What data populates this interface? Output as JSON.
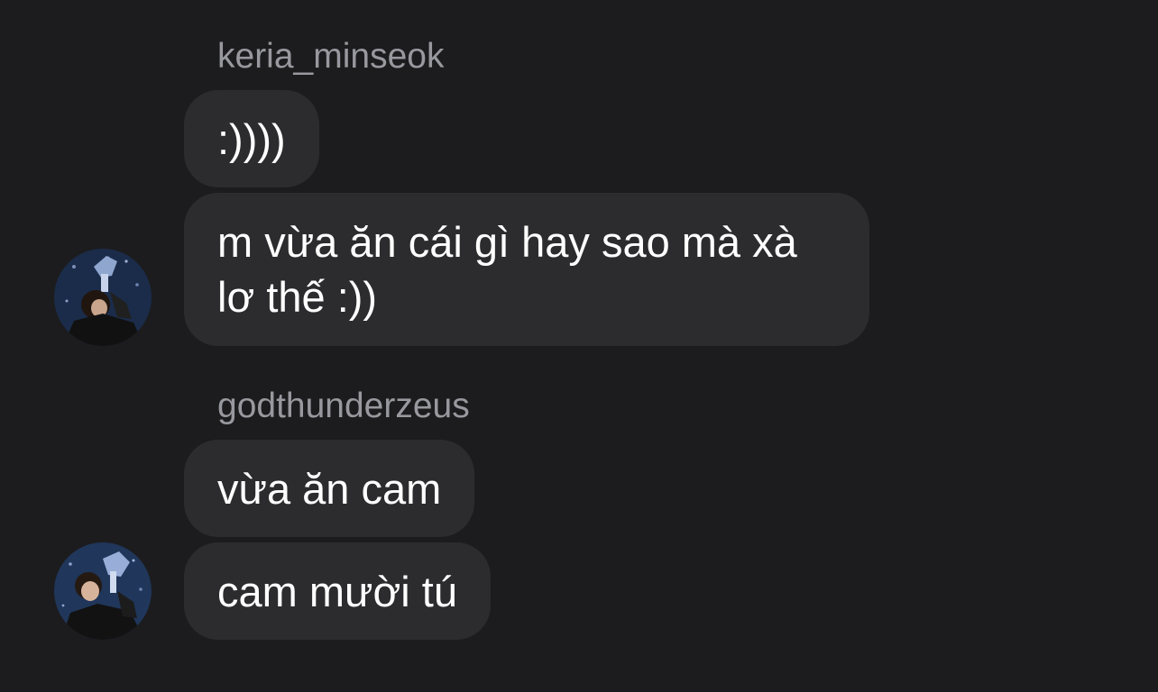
{
  "messages": [
    {
      "sender": "keria_minseok",
      "bubbles": [
        ":))))",
        "m vừa ăn cái gì hay sao mà xà lơ thế :))"
      ],
      "avatar_icon": "user-avatar-photo"
    },
    {
      "sender": "godthunderzeus",
      "bubbles": [
        "vừa ăn cam",
        "cam mười tú"
      ],
      "avatar_icon": "user-avatar-photo"
    }
  ],
  "colors": {
    "background": "#1c1c1e",
    "bubble": "#2c2c2e",
    "sender_text": "#98989f",
    "message_text": "#ffffff"
  }
}
